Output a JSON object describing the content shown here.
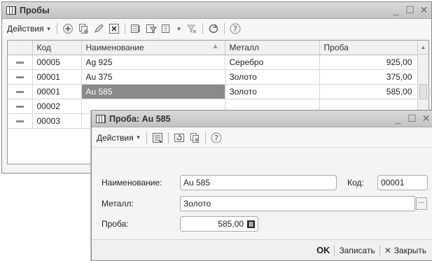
{
  "list_window": {
    "title": "Пробы",
    "toolbar": {
      "actions_label": "Действия"
    },
    "columns": [
      "Код",
      "Наименование",
      "Металл",
      "Проба"
    ],
    "rows": [
      {
        "code": "00005",
        "name": "Ag 925",
        "metal": "Серебро",
        "assay": "925,00"
      },
      {
        "code": "00001",
        "name": "Au 375",
        "metal": "Золото",
        "assay": "375,00"
      },
      {
        "code": "00001",
        "name": "Au 585",
        "metal": "Золото",
        "assay": "585,00"
      },
      {
        "code": "00002",
        "name": "",
        "metal": "",
        "assay": ""
      },
      {
        "code": "00003",
        "name": "",
        "metal": "",
        "assay": ""
      }
    ],
    "selected_row": 2
  },
  "form_window": {
    "title": "Проба: Au 585",
    "toolbar": {
      "actions_label": "Действия"
    },
    "fields": {
      "name_label": "Наименование:",
      "name_value": "Au 585",
      "code_label": "Код:",
      "code_value": "00001",
      "metal_label": "Металл:",
      "metal_value": "Золото",
      "assay_label": "Проба:",
      "assay_value": "585,00"
    },
    "footer": {
      "ok_label": "OK",
      "save_label": "Записать",
      "close_label": "Закрыть"
    }
  },
  "icons": [
    "table-icon",
    "add-icon",
    "copy-icon",
    "edit-icon",
    "delete-icon",
    "filter-icon",
    "refresh-icon",
    "help-icon",
    "calculator-icon"
  ]
}
